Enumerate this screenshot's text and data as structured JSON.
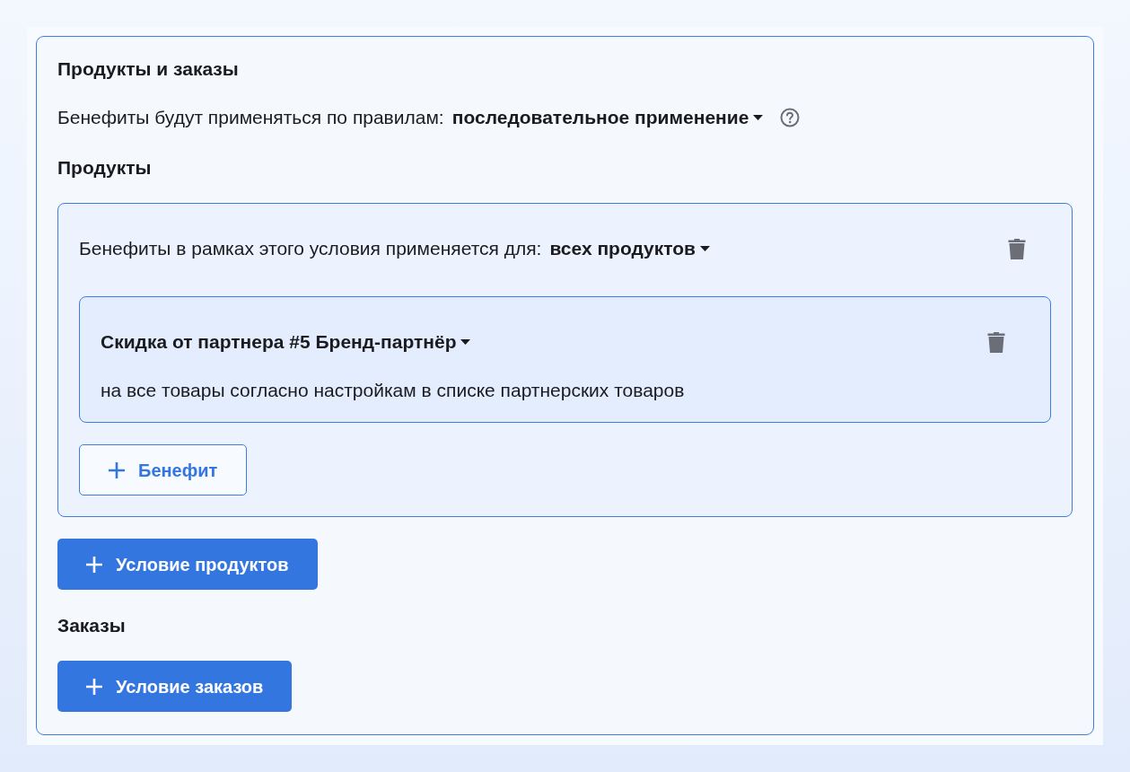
{
  "section": {
    "title": "Продукты и заказы",
    "rule": {
      "label": "Бенефиты будут применяться по правилам:",
      "value": "последовательное применение"
    },
    "products": {
      "title": "Продукты",
      "conditions": [
        {
          "label": "Бенефиты в рамках этого условия применяется для:",
          "value": "всех продуктов",
          "benefits": [
            {
              "title": "Скидка от партнера #5 Бренд-партнёр",
              "description": "на все товары согласно настройкам в списке партнерских товаров"
            }
          ],
          "add_benefit_button": "Бенефит"
        }
      ],
      "add_button": "Условие продуктов"
    },
    "orders": {
      "title": "Заказы",
      "add_button": "Условие заказов"
    }
  }
}
